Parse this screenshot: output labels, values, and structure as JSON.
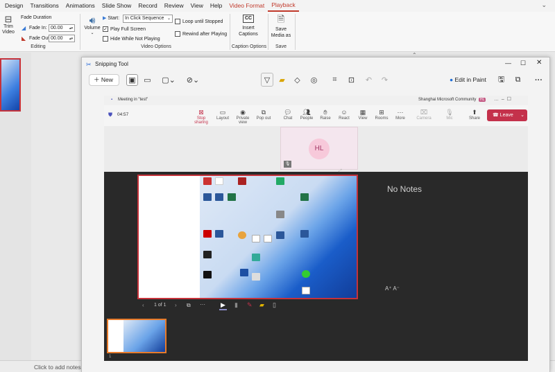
{
  "ribbon": {
    "tabs": [
      "Design",
      "Transitions",
      "Animations",
      "Slide Show",
      "Record",
      "Review",
      "View",
      "Help",
      "Video Format",
      "Playback"
    ],
    "trim_label": "Trim Video",
    "fade_duration": "Fade Duration",
    "fade_in_label": "Fade In:",
    "fade_in_value": "00.00",
    "fade_out_label": "Fade Out:",
    "fade_out_value": "00.00",
    "editing_group": "Editing",
    "volume_label": "Volume",
    "start_label": "Start:",
    "start_value": "In Click Sequence",
    "play_full_screen": "Play Full Screen",
    "hide_while_not_playing": "Hide While Not Playing",
    "loop_until_stopped": "Loop until Stopped",
    "rewind_after_playing": "Rewind after Playing",
    "video_options_group": "Video Options",
    "insert_captions": "Insert Captions",
    "captions_icon_text": "CC",
    "caption_options_group": "Caption Options",
    "save_media_as": "Save Media as",
    "save_group": "Save"
  },
  "notes_placeholder": "Click to add notes",
  "snipping": {
    "title": "Snipping Tool",
    "new_label": "New",
    "edit_in_paint": "Edit in Paint",
    "more": "···"
  },
  "teams": {
    "meeting_title": "Meeting in \"test\"",
    "org": "Shanghai Microsoft Community",
    "org_badge": "HL",
    "timer": "04:57",
    "toolbar": [
      "Stop sharing",
      "Layout",
      "Private view",
      "Pop out",
      "Chat",
      "People",
      "Raise",
      "React",
      "View",
      "Rooms",
      "More",
      "Camera",
      "Mic",
      "Share"
    ],
    "leave": "Leave",
    "avatar": "HL",
    "no_notes": "No Notes",
    "page_indicator": "1 of 1",
    "font_controls": "A⁺ A⁻",
    "thumb_number": "1"
  },
  "colors": {
    "accent": "#c0392b",
    "leave": "#c4314b",
    "teams_bg": "#292929"
  }
}
